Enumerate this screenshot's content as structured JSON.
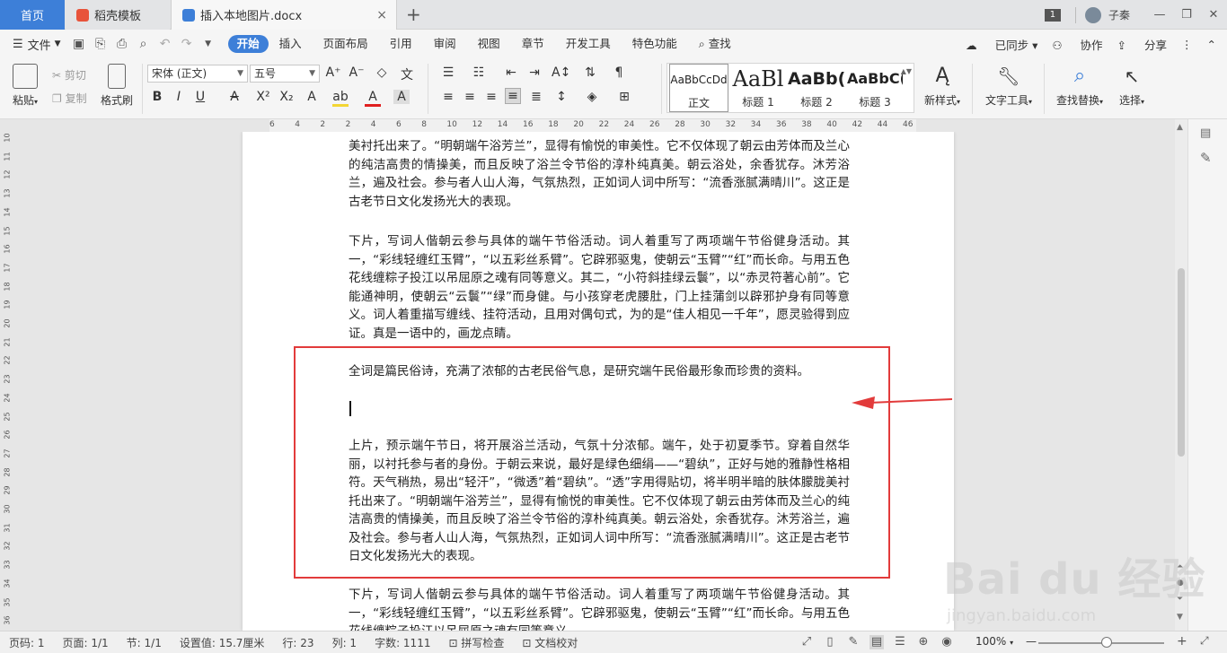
{
  "tabs": {
    "home": "首页",
    "shell": "稻壳模板",
    "doc": "插入本地图片.docx",
    "close": "×",
    "plus": "+"
  },
  "window": {
    "badge": "1",
    "user": "子秦",
    "min": "—",
    "max": "❐",
    "close": "✕"
  },
  "menu": {
    "file": "文件",
    "tabs": [
      "开始",
      "插入",
      "页面布局",
      "引用",
      "审阅",
      "视图",
      "章节",
      "开发工具",
      "特色功能"
    ],
    "search": "查找",
    "synced": "已同步",
    "collab": "协作",
    "share": "分享"
  },
  "ribbon": {
    "paste": "粘贴",
    "cut": "剪切",
    "copy": "复制",
    "format_painter": "格式刷",
    "font_name": "宋体 (正文)",
    "font_size": "五号",
    "styles": [
      {
        "sample": "AaBbCcDd",
        "name": "正文"
      },
      {
        "sample": "AaBl",
        "name": "标题 1"
      },
      {
        "sample": "AaBb(",
        "name": "标题 2"
      },
      {
        "sample": "AaBbC(",
        "name": "标题 3"
      }
    ],
    "new_style": "新样式",
    "text_tools": "文字工具",
    "find_replace": "查找替换",
    "select": "选择"
  },
  "ruler": {
    "h_ticks": [
      "6",
      "4",
      "2",
      "2",
      "4",
      "6",
      "8",
      "10",
      "12",
      "14",
      "16",
      "18",
      "20",
      "22",
      "24",
      "26",
      "28",
      "30",
      "32",
      "34",
      "36",
      "38",
      "40",
      "42",
      "44",
      "46"
    ],
    "v_ticks": [
      "10",
      "11",
      "12",
      "13",
      "14",
      "15",
      "16",
      "17",
      "18",
      "19",
      "20",
      "21",
      "22",
      "23",
      "24",
      "25",
      "26",
      "27",
      "28",
      "29",
      "30",
      "31",
      "32",
      "33",
      "34",
      "35",
      "36"
    ]
  },
  "document": {
    "p1": "美衬托出来了。“明朝端午浴芳兰”，显得有愉悦的审美性。它不仅体现了朝云由芳体而及兰心的纯洁高贵的情操美，而且反映了浴兰令节俗的淳朴纯真美。朝云浴处，余香犹存。沐芳浴兰，遍及社会。参与者人山人海，气氛热烈，正如词人词中所写：“流香涨腻满晴川”。这正是古老节日文化发扬光大的表现。",
    "p2": "下片，写词人偕朝云参与具体的端午节俗活动。词人着重写了两项端午节俗健身活动。其一，“彩线轻缠红玉臂”，“以五彩丝系臂”。它辟邪驱鬼，使朝云“玉臂”“红”而长命。与用五色花线缠粽子投江以吊屈原之魂有同等意义。其二，“小符斜挂绿云鬟”，以“赤灵符著心前”。它能通神明，使朝云“云鬟”“绿”而身健。与小孩穿老虎腰肚，门上挂蒲剑以辟邪护身有同等意义。词人着重描写缠线、挂符活动，且用对偶句式，为的是“佳人相见一千年”，愿灵验得到应证。真是一语中的，画龙点睛。",
    "p3": "全词是篇民俗诗，充满了浓郁的古老民俗气息，是研究端午民俗最形象而珍贵的资料。",
    "p4": "上片，预示端午节日，将开展浴兰活动，气氛十分浓郁。端午，处于初夏季节。穿着自然华丽，以衬托参与者的身份。于朝云来说，最好是绿色细绢——“碧纨”，正好与她的雅静性格相符。天气稍热，易出“轻汗”，“微透”着“碧纨”。“透”字用得贴切，将半明半暗的肤体朦胧美衬托出来了。“明朝端午浴芳兰”，显得有愉悦的审美性。它不仅体现了朝云由芳体而及兰心的纯洁高贵的情操美，而且反映了浴兰令节俗的淳朴纯真美。朝云浴处，余香犹存。沐芳浴兰，遍及社会。参与者人山人海，气氛热烈，正如词人词中所写：“流香涨腻满晴川”。这正是古老节日文化发扬光大的表现。",
    "p5": "下片，写词人偕朝云参与具体的端午节俗活动。词人着重写了两项端午节俗健身活动。其一，“彩线轻缠红玉臂”，“以五彩丝系臂”。它辟邪驱鬼，使朝云“玉臂”“红”而长命。与用五色花线缠粽子投江以吊屈原之魂有同等意义。"
  },
  "status": {
    "page_no": "页码: 1",
    "pages": "页面: 1/1",
    "section": "节: 1/1",
    "setting": "设置值: 15.7厘米",
    "line": "行: 23",
    "col": "列: 1",
    "words": "字数: 1111",
    "spell": "拼写检查",
    "proof": "文档校对",
    "zoom": "100%"
  },
  "watermark": {
    "logo": "Bai du 经验",
    "url": "jingyan.baidu.com"
  },
  "colors": {
    "accent": "#3d7fd8",
    "highlight_box": "#e23b3b"
  }
}
